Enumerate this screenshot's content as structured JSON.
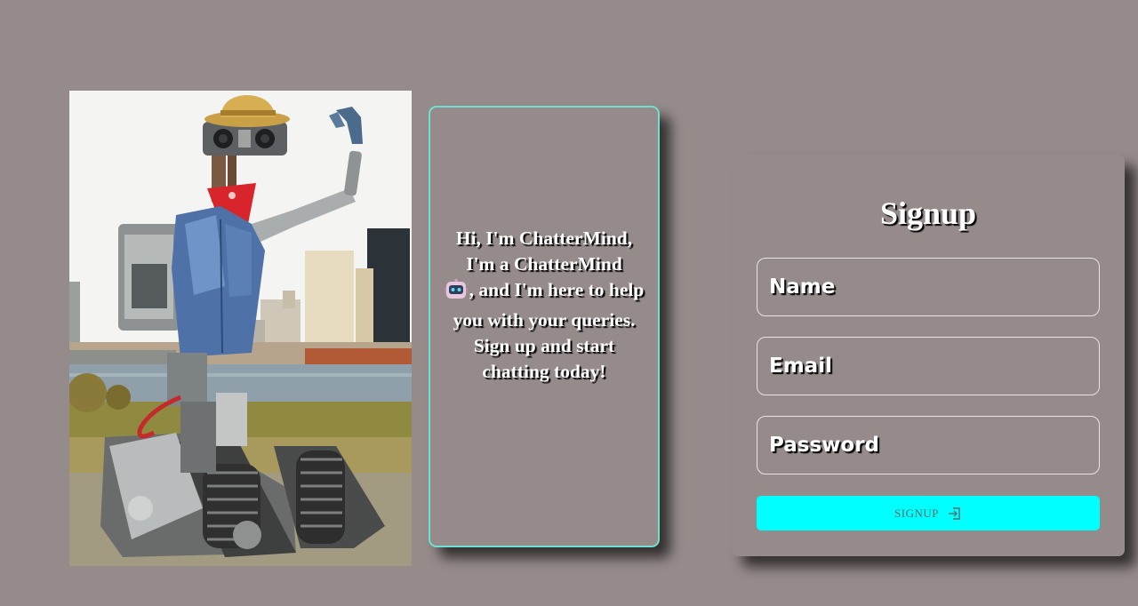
{
  "intro": {
    "text_before_emoji": "Hi, I'm ChatterMind, I'm a ChatterMind",
    "emoji_icon": "robot-face-icon",
    "text_after_emoji": ", and I'm here to help you with your queries. Sign up and start chatting today!"
  },
  "signup": {
    "title": "Signup",
    "name_placeholder": "Name",
    "email_placeholder": "Email",
    "password_placeholder": "Password",
    "button_label": "SIGNUP",
    "button_icon": "sign-in-arrow-icon"
  },
  "colors": {
    "page_background": "#958b8a",
    "card_border_accent": "#6fe0cf",
    "button_background": "#00ffff",
    "text": "#ffffff"
  }
}
